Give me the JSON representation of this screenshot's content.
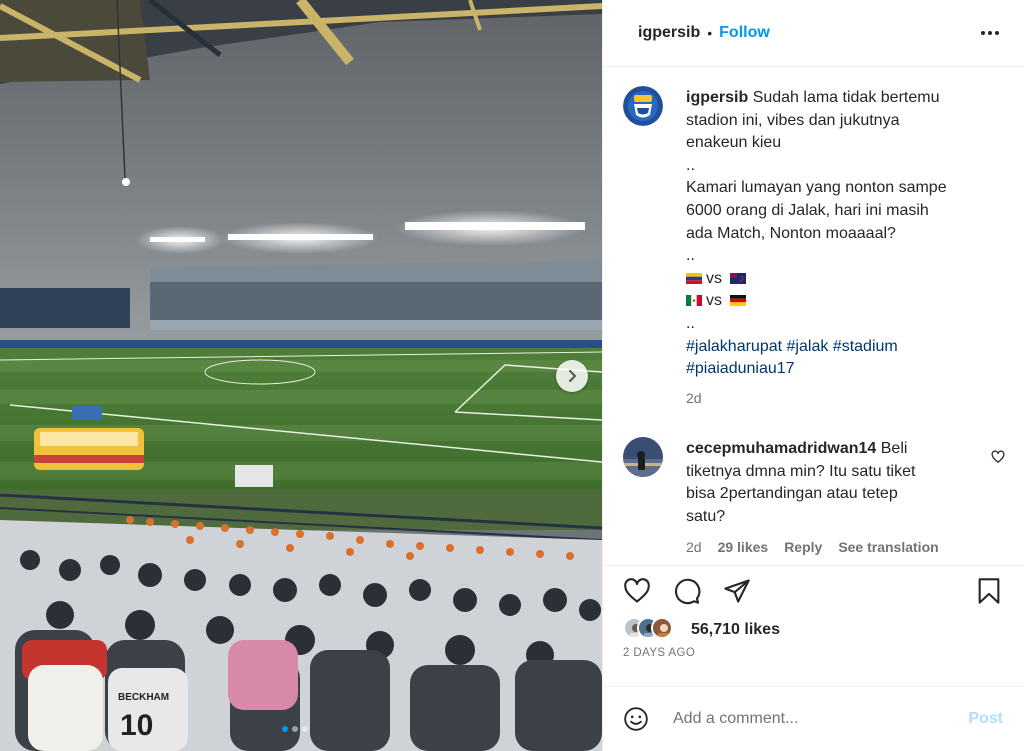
{
  "post": {
    "username": "igpersib",
    "follow_label": "Follow",
    "caption": {
      "username": "igpersib",
      "lines": [
        "Sudah lama tidak bertemu",
        "stadion ini, vibes dan jukutnya",
        "enakeun kieu",
        "..",
        "Kamari lumayan yang nonton sampe",
        "6000 orang di Jalak, hari ini masih",
        "ada Match, Nonton moaaaal?",
        "..",
        "vs",
        "vs",
        ".."
      ],
      "hashtags": [
        "#jalakharupat",
        "#jalak",
        "#stadium",
        "#piaiaduniau17"
      ],
      "time": "2d"
    },
    "comment": {
      "username": "cecepmuhamadridwan14",
      "text_lines": [
        "Beli",
        "tiketnya dmna min? Itu satu tiket",
        "bisa 2pertandingan atau tetep",
        "satu?"
      ],
      "time": "2d",
      "likes": "29 likes",
      "reply": "Reply",
      "see_translation": "See translation"
    },
    "likes_count": "56,710 likes",
    "post_date": "2 DAYS AGO",
    "add_comment_placeholder": "Add a comment...",
    "post_button": "Post",
    "icons": {
      "more": "more-options-icon",
      "heart": "heart-icon",
      "comment": "comment-icon",
      "share": "share-icon",
      "save": "bookmark-icon",
      "emoji": "emoji-icon",
      "next": "chevron-right-icon"
    },
    "colors": {
      "accent": "#0095f6",
      "hashtag": "#00376b",
      "muted": "#737373"
    },
    "carousel": {
      "total": 3,
      "active_index": 0
    }
  }
}
